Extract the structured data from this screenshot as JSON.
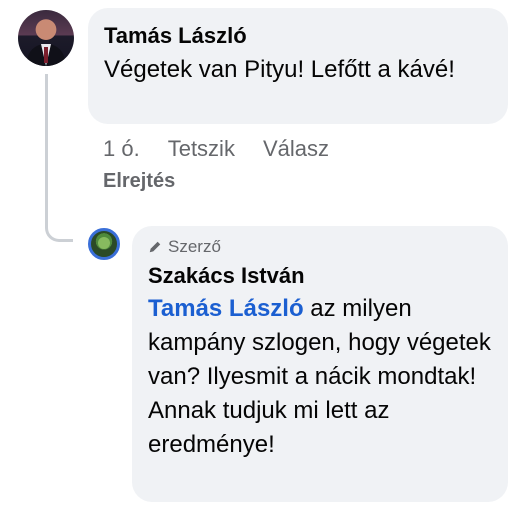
{
  "comment": {
    "author": "Tamás László",
    "text": "Végetek van Pityu! Lefőtt a kávé!",
    "time": "1 ó.",
    "like_label": "Tetszik",
    "reply_label": "Válasz"
  },
  "hide_label": "Elrejtés",
  "reply": {
    "badge": "Szerző",
    "author": "Szakács István",
    "mention": "Tamás László",
    "text": " az milyen kampány szlogen, hogy végetek van? Ilyesmit a nácik mondtak! Annak tudjuk mi lett az eredménye!"
  },
  "icons": {
    "badge_icon": "pencil-icon"
  }
}
